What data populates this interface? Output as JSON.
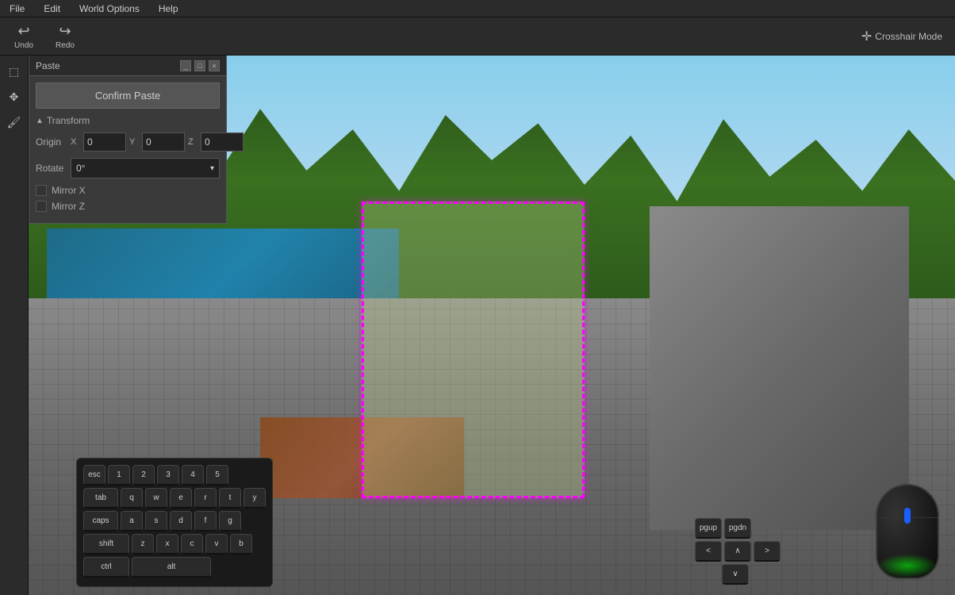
{
  "menubar": {
    "items": [
      "File",
      "Edit",
      "World Options",
      "Help"
    ]
  },
  "toolbar": {
    "undo_label": "Undo",
    "redo_label": "Redo",
    "crosshair_label": "Crosshair Mode"
  },
  "paste_panel": {
    "title": "Paste",
    "confirm_button": "Confirm Paste",
    "transform_section": "Transform",
    "origin_label": "Origin",
    "x_label": "X",
    "y_label": "Y",
    "z_label": "Z",
    "x_value": "0",
    "y_value": "0",
    "z_value": "0",
    "rotate_label": "Rotate",
    "rotate_value": "0°",
    "mirror_x_label": "Mirror X",
    "mirror_z_label": "Mirror Z"
  },
  "keyboard": {
    "rows": [
      [
        "esc",
        "1",
        "2",
        "3",
        "4",
        "5"
      ],
      [
        "tab",
        "q",
        "w",
        "e",
        "r",
        "t",
        "y"
      ],
      [
        "caps",
        "a",
        "s",
        "d",
        "f",
        "g"
      ],
      [
        "shift",
        "z",
        "x",
        "c",
        "v",
        "b"
      ],
      [
        "ctrl",
        "alt"
      ]
    ],
    "nav": {
      "top": [
        "pgup",
        "pgdn"
      ],
      "mid": [
        "<",
        "∧",
        ">"
      ],
      "bot": [
        "∨"
      ]
    }
  },
  "colors": {
    "accent": "#ff00ff",
    "toolbar_bg": "#2b2b2b",
    "panel_bg": "#3a3a3a",
    "viewport_bg": "#4a5a3a"
  }
}
